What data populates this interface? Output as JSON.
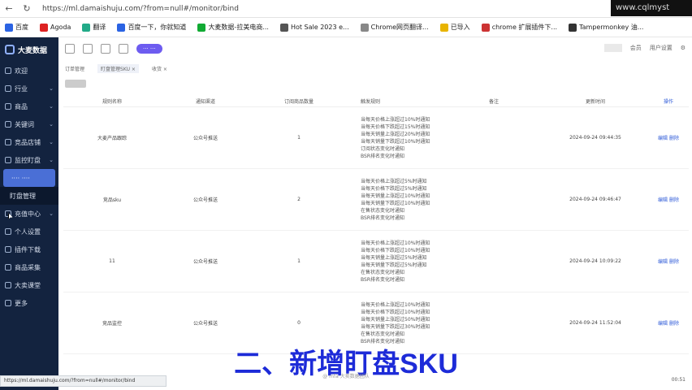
{
  "browser": {
    "url": "https://ml.damaishuju.com/?from=null#/monitor/bind",
    "watermark": "www.cqlmyst"
  },
  "bookmarks": [
    {
      "label": "百度",
      "color": "#2b63e3"
    },
    {
      "label": "Agoda",
      "color": "#d22"
    },
    {
      "label": "翻译",
      "color": "#2a8"
    },
    {
      "label": "百度一下，你就知道",
      "color": "#2b63e3"
    },
    {
      "label": "大麦数据-拉美电商...",
      "color": "#1a3"
    },
    {
      "label": "Hot Sale 2023 e...",
      "color": "#555"
    },
    {
      "label": "Chrome网页翻译...",
      "color": "#888"
    },
    {
      "label": "已导入",
      "color": "#e8b400"
    },
    {
      "label": "chrome 扩展插件下...",
      "color": "#c33"
    },
    {
      "label": "Tampermonkey 油...",
      "color": "#333"
    }
  ],
  "app": {
    "name": "大麦数据"
  },
  "sidebar": {
    "items": [
      {
        "label": "欢迎",
        "has_chevron": false
      },
      {
        "label": "行业",
        "has_chevron": true
      },
      {
        "label": "商品",
        "has_chevron": true
      },
      {
        "label": "关键词",
        "has_chevron": true
      },
      {
        "label": "竞品店铺",
        "has_chevron": true
      },
      {
        "label": "监控盯盘",
        "has_chevron": true
      }
    ],
    "sub_items": [
      {
        "label": "···· ····"
      },
      {
        "label": "盯盘管理"
      }
    ],
    "more_items": [
      {
        "label": "充值中心",
        "has_chevron": true
      },
      {
        "label": "个人设置"
      },
      {
        "label": "插件下载"
      },
      {
        "label": "商品采集"
      },
      {
        "label": "大卖课堂"
      },
      {
        "label": "更多"
      }
    ]
  },
  "topbar": {
    "chip": "··· ···",
    "right": [
      "会员",
      "用户设置"
    ]
  },
  "tabs": [
    {
      "label": "订单管理",
      "active": false
    },
    {
      "label": "盯盘管理SKU",
      "active": true
    },
    {
      "label": "收货",
      "active": false
    }
  ],
  "table": {
    "headers": [
      "规则名称",
      "通知渠道",
      "订阅商品数量",
      "触发规则",
      "备注",
      "更新时间",
      "操作"
    ],
    "rows": [
      {
        "name": "大麦产品跟踪",
        "channel": "公众号推送",
        "count": "1",
        "note": "",
        "time": "2024-09-24 09:44:35",
        "op": "编辑 删除",
        "rules": [
          "当每天价格上涨超过10%时通知",
          "当每天价格下跌超过15%时通知",
          "当每天销量上涨超过20%时通知",
          "当每天销量下跌超过10%时通知",
          "订阅状态变化时通知",
          "BSR排名变化时通知"
        ]
      },
      {
        "name": "竞品sku",
        "channel": "公众号推送",
        "count": "2",
        "note": "",
        "time": "2024-09-24 09:46:47",
        "op": "编辑 删除",
        "rules": [
          "当每天价格上涨超过5%时通知",
          "当每天价格下跌超过5%时通知",
          "当每天销量上涨超过10%时通知",
          "当每天销量下跌超过10%时通知",
          "在售状态变化时通知",
          "BSR排名变化时通知"
        ]
      },
      {
        "name": "11",
        "channel": "公众号推送",
        "count": "1",
        "note": "",
        "time": "2024-09-24 10:09:22",
        "op": "编辑 删除",
        "rules": [
          "当每天价格上涨超过10%时通知",
          "当每天价格下跌超过10%时通知",
          "当每天销量上涨超过5%时通知",
          "当每天销量下跌超过5%时通知",
          "在售状态变化时通知",
          "BSR排名变化时通知"
        ]
      },
      {
        "name": "竞品监控",
        "channel": "公众号推送",
        "count": "0",
        "note": "",
        "time": "2024-09-24 11:52:04",
        "op": "编辑 删除",
        "rules": [
          "当每天价格上涨超过10%时通知",
          "当每天价格下跌超过10%时通知",
          "当每天销量上涨超过50%时通知",
          "当每天销量下跌超过30%时通知",
          "在售状态变化时通知",
          "BSR排名变化时通知"
        ]
      }
    ]
  },
  "overlay": {
    "subtitle": "二、新增盯盘SKU",
    "caption": "@ mfa 大卖数据团队"
  },
  "statusbar": {
    "text": "https://ml.damaishuju.com/?from=null#/monitor/bind",
    "corner": "00:51"
  }
}
